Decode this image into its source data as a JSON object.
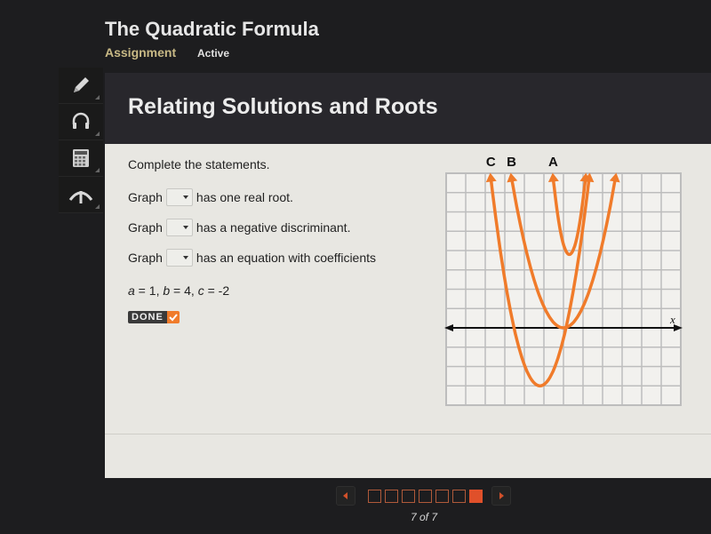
{
  "header": {
    "title": "The Quadratic Formula",
    "nav_assignment": "Assignment",
    "nav_status": "Active"
  },
  "toolbar": {
    "tools": [
      {
        "icon": "pencil-icon"
      },
      {
        "icon": "headphones-icon"
      },
      {
        "icon": "calculator-icon"
      },
      {
        "icon": "reference-icon"
      }
    ]
  },
  "panel": {
    "title": "Relating Solutions and Roots",
    "prompt": "Complete the statements.",
    "statements": [
      {
        "prefix": "Graph",
        "selected": "",
        "suffix": "has one real root."
      },
      {
        "prefix": "Graph",
        "selected": "",
        "suffix": "has a negative discriminant."
      },
      {
        "prefix": "Graph",
        "selected": "",
        "suffix": "has an equation with coefficients"
      }
    ],
    "coefficients": {
      "a_label": "a",
      "a": "1",
      "b_label": "b",
      "b": "4",
      "c_label": "c",
      "c": "-2"
    },
    "done_label": "DONE"
  },
  "chart_data": {
    "type": "line",
    "title": "",
    "xlabel": "x",
    "ylabel": "",
    "xlim": [
      -6,
      6
    ],
    "ylim": [
      -4,
      8
    ],
    "grid": true,
    "series": [
      {
        "name": "A",
        "equation_form": "vertex",
        "vertex": [
          0.3,
          3.8
        ],
        "a": 5.8,
        "color": "#f07b2a"
      },
      {
        "name": "B",
        "equation_form": "vertex",
        "vertex": [
          0,
          0
        ],
        "a": 1.1,
        "color": "#f07b2a"
      },
      {
        "name": "C",
        "equation_form": "vertex",
        "vertex": [
          -1.2,
          -3
        ],
        "a": 1.7,
        "color": "#f07b2a"
      }
    ],
    "labels": [
      "C",
      "B",
      "A"
    ]
  },
  "pagination": {
    "total": 7,
    "current": 7,
    "label": "7 of 7",
    "accent": "#e0502a"
  }
}
